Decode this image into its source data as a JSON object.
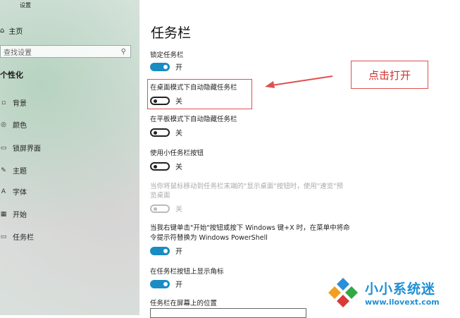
{
  "sidebar": {
    "window_title": "设置",
    "home_label": "主页",
    "search_placeholder": "查找设置",
    "section_title": "个性化",
    "items": [
      {
        "label": "背景",
        "icon": "picture-icon"
      },
      {
        "label": "颜色",
        "icon": "palette-icon"
      },
      {
        "label": "锁屏界面",
        "icon": "lock-screen-icon"
      },
      {
        "label": "主题",
        "icon": "theme-icon"
      },
      {
        "label": "字体",
        "icon": "font-icon"
      },
      {
        "label": "开始",
        "icon": "start-icon"
      },
      {
        "label": "任务栏",
        "icon": "taskbar-icon"
      }
    ]
  },
  "main": {
    "title": "任务栏",
    "settings": [
      {
        "label": "锁定任务栏",
        "state": "开",
        "on": true
      },
      {
        "label": "在桌面模式下自动隐藏任务栏",
        "state": "关",
        "on": false
      },
      {
        "label": "在平板模式下自动隐藏任务栏",
        "state": "关",
        "on": false
      },
      {
        "label": "使用小任务栏按钮",
        "state": "关",
        "on": false
      },
      {
        "label_lines": [
          "当你将鼠标移动到任务栏末端的\"显示桌面\"按钮时，使用\"速览\"预",
          "览桌面"
        ],
        "state": "关",
        "on": false,
        "disabled": true
      },
      {
        "label_lines": [
          "当我右键单击\"开始\"按钮或按下 Windows 键+X 时，在菜单中将命",
          "令提示符替换为 Windows PowerShell"
        ],
        "state": "开",
        "on": true
      },
      {
        "label": "在任务栏按钮上显示角标",
        "state": "开",
        "on": true
      }
    ],
    "position_label": "任务栏在屏幕上的位置"
  },
  "annotation": {
    "callout_text": "点击打开",
    "color": "#e05050"
  },
  "watermark": {
    "name": "小小系统迷",
    "url": "www.ilovext.com"
  },
  "colors": {
    "toggle_on": "#1a8cc4",
    "accent_watermark": "#1e8fd6"
  }
}
